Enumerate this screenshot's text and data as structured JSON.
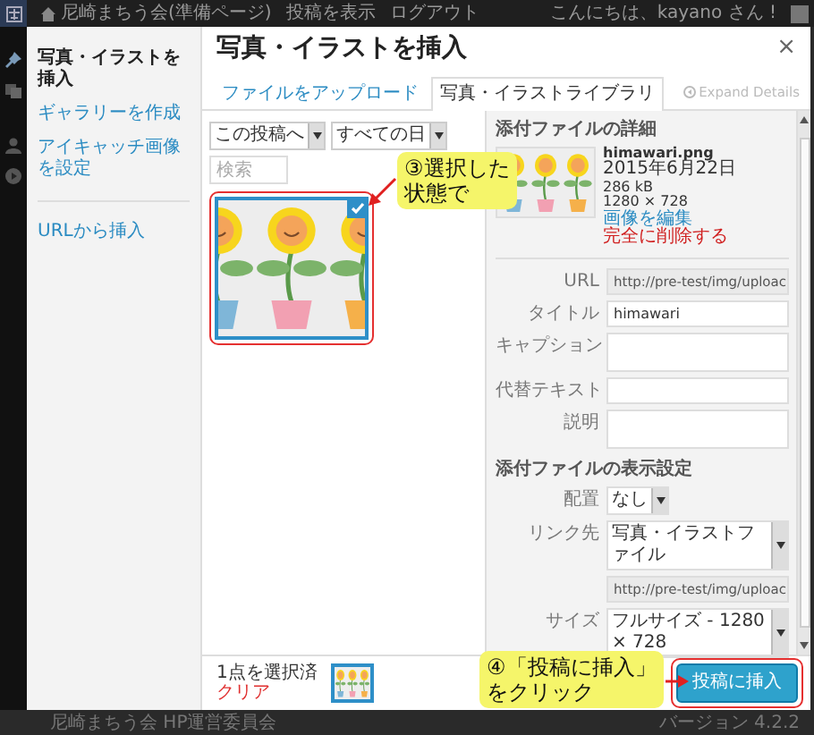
{
  "admin_bar": {
    "site": "尼崎まちう会(準備ページ)",
    "links": [
      "投稿を表示",
      "ログアウト"
    ],
    "greeting": "こんにちは、kayano さん !"
  },
  "modal": {
    "title": "写真・イラストを挿入",
    "close": "×",
    "menu": [
      {
        "label": "写真・イラストを挿入",
        "selected": true
      },
      {
        "label": "ギャラリーを作成",
        "selected": false
      },
      {
        "label": "アイキャッチ画像を設定",
        "selected": false
      },
      {
        "label": "URLから挿入",
        "selected": false
      }
    ],
    "tabs": [
      {
        "label": "ファイルをアップロード",
        "selected": false
      },
      {
        "label": "写真・イラストライブラリ",
        "selected": true
      }
    ],
    "expand_details": "Expand Details",
    "filters": [
      "この投稿へ",
      "すべての日"
    ],
    "search": {
      "placeholder": "検索"
    },
    "attachments": [
      {
        "selected": true
      }
    ],
    "details": {
      "heading": "添付ファイルの詳細",
      "filename": "himawari.png",
      "date": "2015年6月22日",
      "size": "286 kB",
      "dimensions": "1280 × 728",
      "edit_link": "画像を編集",
      "delete_link": "完全に削除する",
      "fields": [
        {
          "label": "URL",
          "value": "http://pre-test/img/uploac",
          "kind": "readonly"
        },
        {
          "label": "タイトル",
          "value": "himawari",
          "kind": "text"
        },
        {
          "label": "キャプション",
          "kind": "textarea"
        },
        {
          "label": "代替テキスト",
          "kind": "text"
        },
        {
          "label": "説明",
          "kind": "textarea"
        }
      ]
    },
    "display_settings": {
      "heading": "添付ファイルの表示設定",
      "rows": [
        {
          "label": "配置",
          "value": "なし",
          "kind": "select"
        },
        {
          "label": "リンク先",
          "value": "写真・イラストファイル",
          "kind": "select"
        },
        {
          "value": "http://pre-test/img/uploac",
          "kind": "readonly"
        },
        {
          "label": "サイズ",
          "value": "フルサイズ - 1280 × 728",
          "kind": "select"
        }
      ]
    },
    "selection": {
      "count": "1点を選択済",
      "clear": "クリア"
    },
    "insert_button": "投稿に挿入"
  },
  "annotations": [
    {
      "lines": [
        "③選択した",
        "状態で"
      ]
    },
    {
      "lines": [
        "④「投稿に挿入」",
        "をクリック"
      ]
    }
  ],
  "footer": {
    "left": "尼崎まちう会 HP運営委員会",
    "right": "バージョン 4.2.2"
  }
}
